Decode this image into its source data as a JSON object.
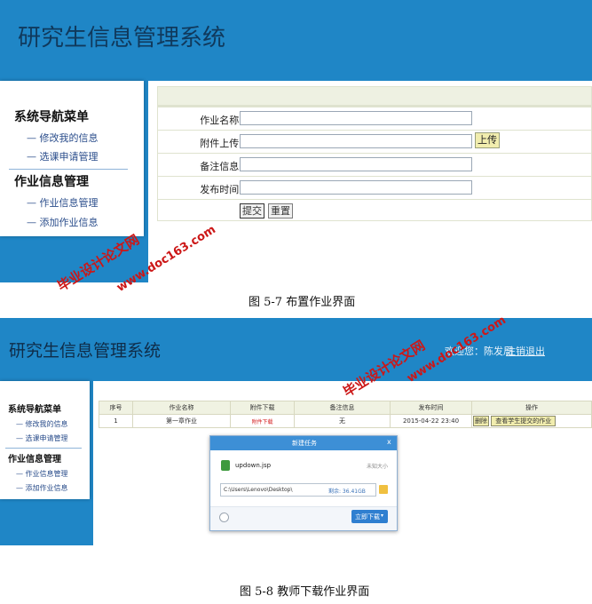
{
  "figure1": {
    "system_title": "研究生信息管理系统",
    "sidebar": {
      "nav_heading": "系统导航菜单",
      "nav_items": [
        "修改我的信息",
        "选课申请管理"
      ],
      "hw_heading": "作业信息管理",
      "hw_items": [
        "作业信息管理",
        "添加作业信息"
      ]
    },
    "form": {
      "rows": [
        {
          "label": "作业名称:",
          "value": ""
        },
        {
          "label": "附件上传:",
          "value": ""
        },
        {
          "label": "备注信息:",
          "value": ""
        },
        {
          "label": "发布时间:",
          "value": ""
        }
      ],
      "upload_button": "上传",
      "submit_button": "提交",
      "reset_button": "重置"
    },
    "caption": "图 5-7 布置作业界面"
  },
  "figure2": {
    "system_title": "研究生信息管理系统",
    "welcome": "欢迎您：陈发局",
    "logout": "注销退出",
    "sidebar": {
      "nav_heading": "系统导航菜单",
      "nav_items": [
        "修改我的信息",
        "选课申请管理"
      ],
      "hw_heading": "作业信息管理",
      "hw_items": [
        "作业信息管理",
        "添加作业信息"
      ]
    },
    "table": {
      "headers": [
        "序号",
        "作业名称",
        "附件下载",
        "备注信息",
        "发布时间",
        "操作"
      ],
      "row": {
        "index": "1",
        "name": "第一章作业",
        "attachment": "附件下载",
        "remark": "无",
        "time": "2015-04-22 23:40",
        "delete": "删除",
        "view": "查看学生提交的作业"
      }
    },
    "dialog": {
      "title": "新建任务",
      "close": "x",
      "filename": "updown.jsp",
      "size": "未知大小",
      "path": "C:\\Users\\Lenovo\\Desktop\\",
      "free": "剩余: 36.41GB",
      "download_button": "立即下载"
    },
    "caption": "图 5-8 教师下载作业界面"
  },
  "watermarks": {
    "cn": "毕业设计论文网",
    "url": "www.doc163.com"
  },
  "colors": {
    "header_blue": "#1f86c6",
    "title_navy": "#10395c",
    "watermark_red": "#cc1717"
  }
}
